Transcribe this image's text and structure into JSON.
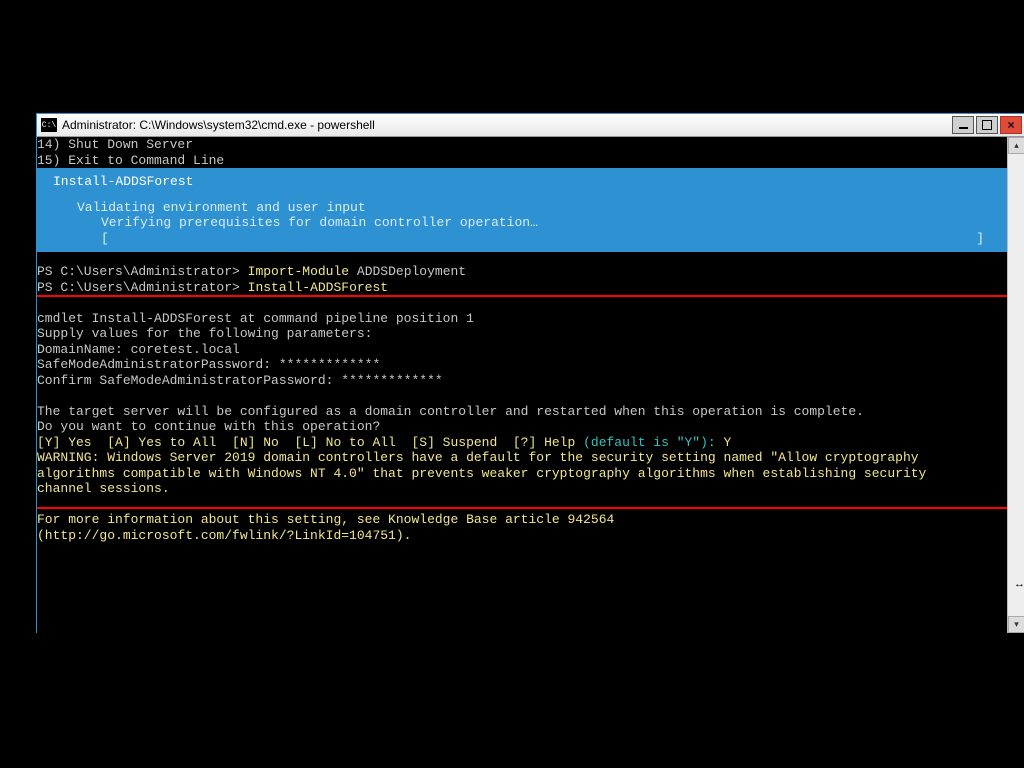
{
  "titlebar": {
    "icon_label": "C:\\",
    "title": "Administrator: C:\\Windows\\system32\\cmd.exe - powershell"
  },
  "menu": {
    "line14": "14) Shut Down Server",
    "line15": "15) Exit to Command Line"
  },
  "band": {
    "cmd": "Install-ADDSForest",
    "line2": "Validating environment and user input",
    "line3": "Verifying prerequisites for domain controller operation…",
    "lbracket": "[",
    "rbracket": "]"
  },
  "ps": {
    "prompt": "PS C:\\Users\\Administrator>",
    "cmd1": "Import-Module",
    "arg1": "ADDSDeployment",
    "cmd2": "Install-ADDSForest"
  },
  "body": {
    "l1": "cmdlet Install-ADDSForest at command pipeline position 1",
    "l2": "Supply values for the following parameters:",
    "l3": "DomainName: coretest.local",
    "l4": "SafeModeAdministratorPassword: *************",
    "l5": "Confirm SafeModeAdministratorPassword: *************",
    "l6": "",
    "l7": "The target server will be configured as a domain controller and restarted when this operation is complete.",
    "l8": "Do you want to continue with this operation?",
    "choices": "[Y] Yes  [A] Yes to All  [N] No  [L] No to All  [S] Suspend  [?] Help ",
    "default": "(default is \"Y\"):",
    "answer": " Y",
    "w1": "WARNING: Windows Server 2019 domain controllers have a default for the security setting named \"Allow cryptography",
    "w2": "algorithms compatible with Windows NT 4.0\" that prevents weaker cryptography algorithms when establishing security",
    "w3": "channel sessions.",
    "w4": "",
    "w5": "For more information about this setting, see Knowledge Base article 942564",
    "w6": "(http://go.microsoft.com/fwlink/?LinkId=104751)."
  },
  "scroll": {
    "up": "▴",
    "down": "▾"
  }
}
